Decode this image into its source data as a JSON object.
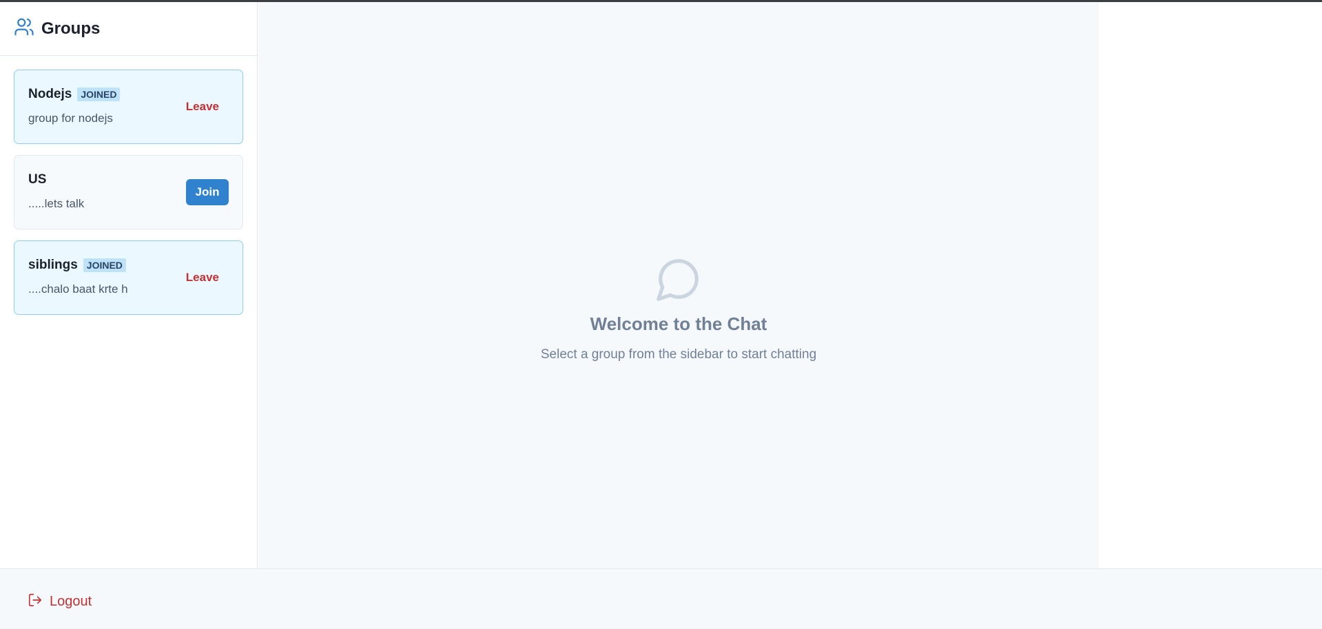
{
  "sidebar": {
    "title": "Groups",
    "groups": [
      {
        "name": "Nodejs",
        "badge": "JOINED",
        "description": "group for nodejs",
        "action": "Leave"
      },
      {
        "name": "US",
        "badge": "",
        "description": ".....lets talk",
        "action": "Join"
      },
      {
        "name": "siblings",
        "badge": "JOINED",
        "description": "....chalo baat krte h",
        "action": "Leave"
      }
    ]
  },
  "main": {
    "icon": "message-circle-icon",
    "title": "Welcome to the Chat",
    "subtitle": "Select a group from the sidebar to start chatting"
  },
  "footer": {
    "logout_label": "Logout",
    "logout_icon": "logout-icon"
  },
  "colors": {
    "accent": "#3182ce",
    "danger": "#c53030",
    "joined_bg": "#ebf8ff",
    "badge_bg": "#bee3f8"
  }
}
